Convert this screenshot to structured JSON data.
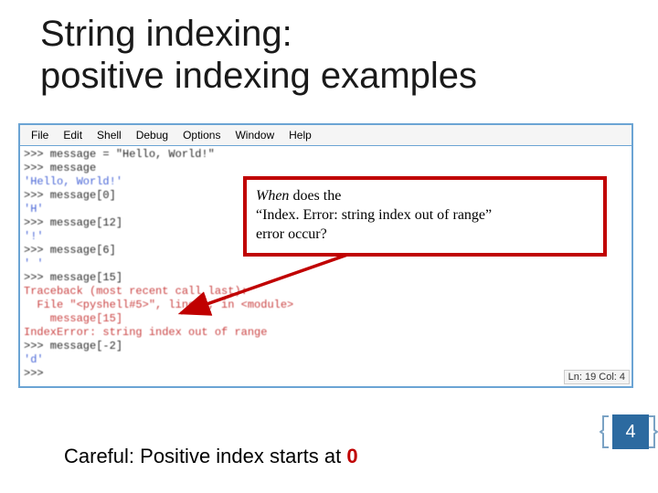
{
  "title_line1": "String indexing:",
  "title_line2": "positive indexing examples",
  "menu": {
    "file": "File",
    "edit": "Edit",
    "shell": "Shell",
    "debug": "Debug",
    "options": "Options",
    "window": "Window",
    "help": "Help"
  },
  "shell": {
    "l1": ">>> message = \"Hello, World!\"",
    "l2": ">>> message",
    "l3": "'Hello, World!'",
    "l4": ">>> message[0]",
    "l5": "'H'",
    "l6": ">>> message[12]",
    "l7": "'!'",
    "l8": ">>> message[6]",
    "l9": "' '",
    "l10": ">>> message[15]",
    "l11": "Traceback (most recent call last):",
    "l12": "  File \"<pyshell#5>\", line 1, in <module>",
    "l13": "    message[15]",
    "l14": "IndexError: string index out of range",
    "l15": ">>> message[-2]",
    "l16": "'d'",
    "l17": ">>> "
  },
  "status": "Ln: 19 Col: 4",
  "callout": {
    "line1_a": "When ",
    "line1_b": "does the",
    "line2": "“Index. Error: string index out of range”",
    "line3": "error occur?"
  },
  "footer": {
    "prefix": "Careful: Positive index starts at ",
    "zero": "0"
  },
  "page_number": "4"
}
